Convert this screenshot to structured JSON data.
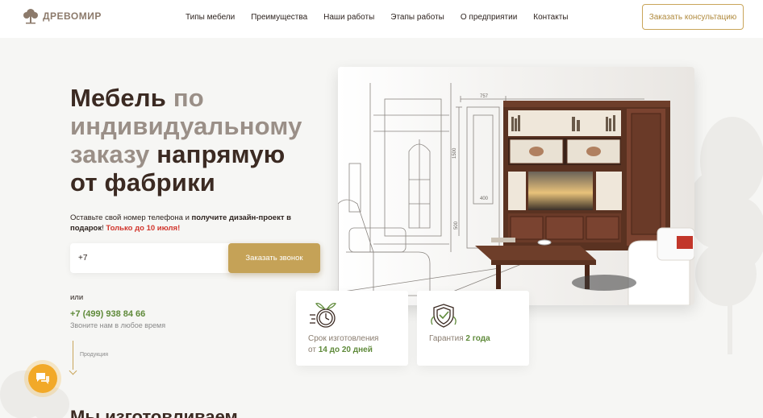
{
  "header": {
    "logo_text": "ДРЕВОМИР",
    "nav": [
      "Типы мебели",
      "Преимущества",
      "Наши работы",
      "Этапы работы",
      "О предприятии",
      "Контакты"
    ],
    "cta_label": "Заказать консультацию"
  },
  "hero": {
    "title_parts": {
      "p1": "Мебель",
      "p2": "по индивидуальному заказу",
      "p3": "напрямую от фабрики"
    },
    "subtitle_plain": "Оставьте свой номер телефона и",
    "subtitle_bold": "получите дизайн-проект в подарок",
    "subtitle_excl": "!",
    "subtitle_red": "Только до 10 июля!",
    "phone_input_value": "+7",
    "call_button_label": "Заказать звонок",
    "or_text": "или",
    "phone": "+7 (499) 938 84 66",
    "phone_hint": "Звоните нам в любое время",
    "scroll_label": "Продукция"
  },
  "image_annotations": {
    "dim_top": "757",
    "dim_side": "1500",
    "dim_mid": "400",
    "dim_low": "500"
  },
  "features": [
    {
      "icon": "clock-icon",
      "line1": "Срок изготовления",
      "prefix": "от ",
      "highlight": "14 до 20 дней"
    },
    {
      "icon": "shield-check-icon",
      "line1": "Гарантия ",
      "highlight": "2 года"
    }
  ],
  "next_section_title": "Мы изготовливаем",
  "colors": {
    "accent": "#c5a257",
    "green": "#5f8a3a",
    "red": "#d1362d",
    "chat": "#f2a928",
    "title_dark": "#3b2a22",
    "title_light": "#9a8f87"
  }
}
